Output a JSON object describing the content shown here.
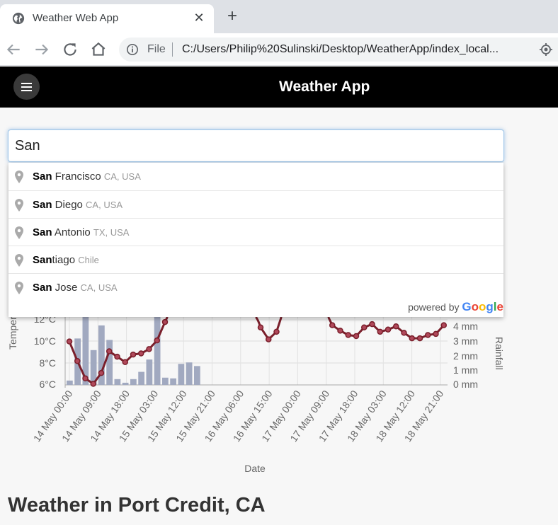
{
  "browser": {
    "tab_title": "Weather Web App",
    "file_label": "File",
    "url": "C:/Users/Philip%20Sulinski/Desktop/WeatherApp/index_local..."
  },
  "app": {
    "title": "Weather App"
  },
  "search": {
    "value": "San",
    "suggestions": [
      {
        "match": "San",
        "rest": " Francisco",
        "secondary": "CA, USA"
      },
      {
        "match": "San",
        "rest": " Diego",
        "secondary": "CA, USA"
      },
      {
        "match": "San",
        "rest": " Antonio",
        "secondary": "TX, USA"
      },
      {
        "match": "San",
        "rest": "tiago",
        "secondary": "Chile"
      },
      {
        "match": "San",
        "rest": " Jose",
        "secondary": "CA, USA"
      }
    ],
    "powered_by": "powered by",
    "google": "Google"
  },
  "chart_data": {
    "type": "line",
    "xlabel": "Date",
    "ylabel_left": "Temperature",
    "ylabel_right": "Rainfall",
    "left_ticks": [
      "12°C",
      "10°C",
      "8°C",
      "6°C"
    ],
    "right_ticks": [
      "4 mm",
      "3 mm",
      "2 mm",
      "1 mm",
      "0 mm"
    ],
    "ylim_left": [
      6,
      12
    ],
    "ylim_right": [
      0,
      4
    ],
    "x_tick_labels": [
      "14 May 00:00",
      "14 May 09:00",
      "14 May 18:00",
      "15 May 03:00",
      "15 May 12:00",
      "15 May 21:00",
      "16 May 06:00",
      "16 May 15:00",
      "17 May 00:00",
      "17 May 09:00",
      "17 May 18:00",
      "18 May 03:00",
      "18 May 12:00",
      "18 May 21:00"
    ],
    "series": [
      {
        "name": "Temperature",
        "color": "#7a1f2b",
        "values": [
          10.0,
          8.2,
          6.6,
          6.1,
          7.1,
          9.1,
          8.6,
          8.1,
          8.8,
          8.9,
          9.3,
          10.1,
          11.8,
          null,
          null,
          null,
          null,
          null,
          null,
          null,
          null,
          null,
          null,
          null,
          11.3,
          10.2,
          10.9,
          null,
          null,
          null,
          null,
          null,
          null,
          11.5,
          11.0,
          10.6,
          10.5,
          11.3,
          11.6,
          10.9,
          11.1,
          11.4,
          10.8,
          10.3,
          10.3,
          10.6,
          10.7,
          11.5
        ]
      },
      {
        "name": "Rainfall",
        "color": "#a1a9c0",
        "values": [
          0.3,
          3.2,
          5.0,
          2.4,
          4.1,
          3.1,
          0.4,
          0.15,
          0.4,
          0.9,
          1.75,
          4.7,
          0.5,
          0.45,
          1.45,
          1.55,
          1.3,
          0,
          0,
          0,
          0,
          0,
          0,
          0,
          0,
          0,
          0,
          0,
          0,
          0,
          0,
          0,
          0,
          0,
          0,
          0,
          0,
          0,
          0,
          0,
          0,
          0,
          0,
          0,
          0,
          0,
          0,
          0
        ]
      }
    ]
  },
  "page_heading": "Weather in Port Credit, CA"
}
